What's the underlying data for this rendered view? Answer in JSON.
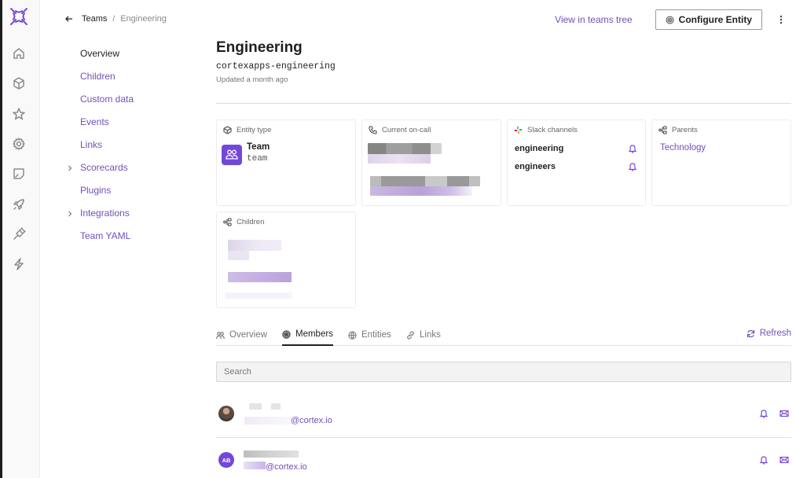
{
  "brand": {
    "accent": "#7450b8",
    "accent_fill": "#7448d6"
  },
  "rail": {
    "items": [
      {
        "icon": "home-icon"
      },
      {
        "icon": "cube-icon"
      },
      {
        "icon": "star-icon"
      },
      {
        "icon": "gear-icon"
      },
      {
        "icon": "note-icon"
      },
      {
        "icon": "rocket-icon"
      },
      {
        "icon": "plug-icon"
      },
      {
        "icon": "lightning-icon"
      }
    ]
  },
  "breadcrumb": {
    "parent": "Teams",
    "separator": "/",
    "current": "Engineering"
  },
  "subnav": {
    "items": [
      {
        "label": "Overview",
        "active": true,
        "expandable": false
      },
      {
        "label": "Children",
        "active": false,
        "expandable": false
      },
      {
        "label": "Custom data",
        "active": false,
        "expandable": false
      },
      {
        "label": "Events",
        "active": false,
        "expandable": false
      },
      {
        "label": "Links",
        "active": false,
        "expandable": false
      },
      {
        "label": "Scorecards",
        "active": false,
        "expandable": true
      },
      {
        "label": "Plugins",
        "active": false,
        "expandable": false
      },
      {
        "label": "Integrations",
        "active": false,
        "expandable": true
      },
      {
        "label": "Team YAML",
        "active": false,
        "expandable": false
      }
    ]
  },
  "header": {
    "view_tree_label": "View in teams tree",
    "configure_label": "Configure Entity"
  },
  "entity": {
    "title": "Engineering",
    "tag": "cortexapps-engineering",
    "updated": "Updated a month ago"
  },
  "cards": {
    "entity_type": {
      "heading": "Entity type",
      "name": "Team",
      "tag": "team"
    },
    "on_call": {
      "heading": "Current on-call"
    },
    "slack": {
      "heading": "Slack channels",
      "channels": [
        {
          "name": "engineering"
        },
        {
          "name": "engineers"
        }
      ]
    },
    "parents": {
      "heading": "Parents",
      "items": [
        "Technology"
      ]
    },
    "children": {
      "heading": "Children"
    }
  },
  "tabs": {
    "items": [
      {
        "label": "Overview",
        "icon": "people-icon",
        "active": false
      },
      {
        "label": "Members",
        "icon": "target-icon",
        "active": true
      },
      {
        "label": "Entities",
        "icon": "globe-icon",
        "active": false
      },
      {
        "label": "Links",
        "icon": "link-icon",
        "active": false
      }
    ],
    "refresh_label": "Refresh"
  },
  "search": {
    "placeholder": "Search",
    "value": ""
  },
  "members": [
    {
      "avatar_type": "photo",
      "initials": "",
      "email_visible": "@cortex.io"
    },
    {
      "avatar_type": "initials",
      "initials": "AB",
      "email_visible": "@cortex.io"
    }
  ]
}
